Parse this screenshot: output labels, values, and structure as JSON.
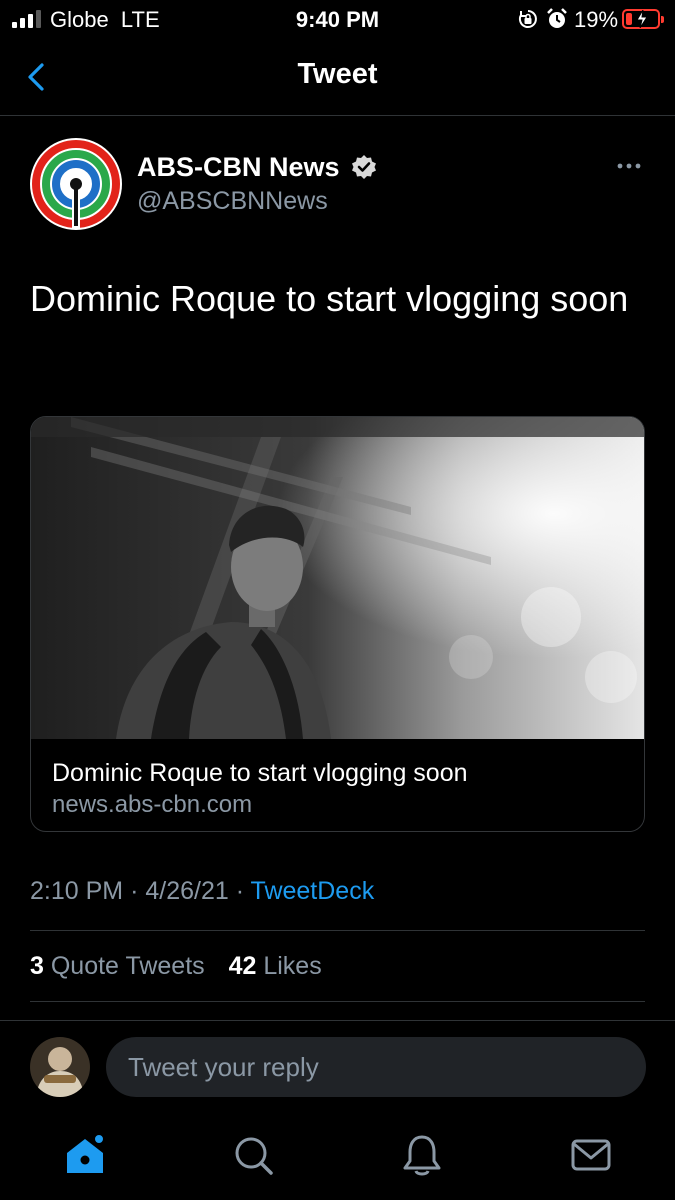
{
  "status_bar": {
    "carrier": "Globe  LTE",
    "time": "9:40 PM",
    "battery_percent": "19%",
    "battery_level": 0.19,
    "icons": [
      "signal-icon",
      "orientation-lock-icon",
      "alarm-icon",
      "battery-charging-icon"
    ]
  },
  "nav": {
    "title": "Tweet",
    "back_icon": "chevron-left-icon"
  },
  "tweet": {
    "author_name": "ABS-CBN News",
    "author_handle": "@ABSCBNNews",
    "verified": true,
    "text": "Dominic Roque to start vlogging soon",
    "card": {
      "title": "Dominic Roque to start vlogging soon",
      "domain": "news.abs-cbn.com"
    },
    "time": "2:10 PM",
    "date": "4/26/21",
    "source": "TweetDeck",
    "quote_tweets_count": "3",
    "quote_tweets_label": "Quote Tweets",
    "likes_count": "42",
    "likes_label": "Likes"
  },
  "reply": {
    "placeholder": "Tweet your reply"
  },
  "tab_bar": {
    "tabs": [
      "home",
      "search",
      "notifications",
      "messages"
    ],
    "active": "home"
  },
  "colors": {
    "background": "#000000",
    "accent": "#1d9bf0",
    "secondary_text": "#8b98a5",
    "divider": "#2f3336",
    "battery_low": "#ff3b30"
  }
}
